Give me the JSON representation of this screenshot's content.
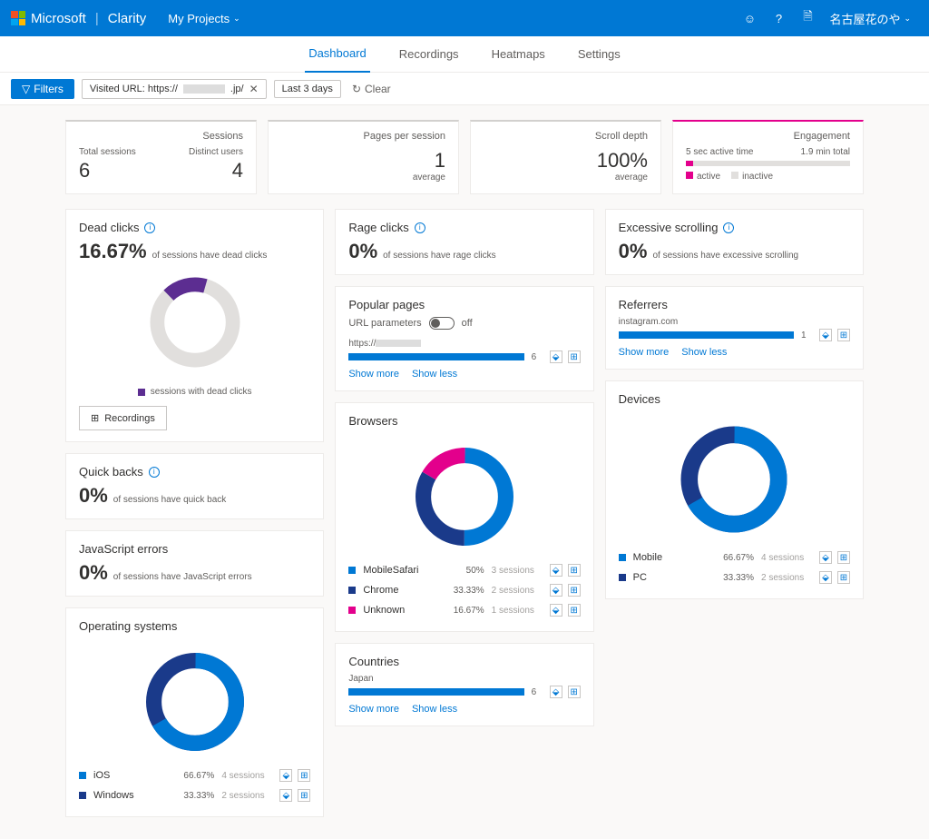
{
  "header": {
    "brand_ms": "Microsoft",
    "brand_app": "Clarity",
    "my_projects": "My Projects",
    "user": "名古屋花のや"
  },
  "tabs": {
    "dashboard": "Dashboard",
    "recordings": "Recordings",
    "heatmaps": "Heatmaps",
    "settings": "Settings"
  },
  "filter_bar": {
    "filters": "Filters",
    "chip_url_prefix": "Visited URL: https://",
    "chip_url_suffix": ".jp/",
    "chip_date": "Last 3 days",
    "clear": "Clear"
  },
  "metrics": {
    "sessions": {
      "title": "Sessions",
      "total_label": "Total sessions",
      "total_value": "6",
      "distinct_label": "Distinct users",
      "distinct_value": "4"
    },
    "pps": {
      "title": "Pages per session",
      "value": "1",
      "sub": "average"
    },
    "scroll": {
      "title": "Scroll depth",
      "value": "100%",
      "sub": "average"
    },
    "engagement": {
      "title": "Engagement",
      "active_label": "5 sec active time",
      "total_label": "1.9 min total",
      "legend_active": "active",
      "legend_inactive": "inactive"
    }
  },
  "cards": {
    "dead_clicks": {
      "title": "Dead clicks",
      "pct": "16.67%",
      "desc": "of sessions have dead clicks",
      "legend": "sessions with dead clicks",
      "btn": "Recordings"
    },
    "quick_backs": {
      "title": "Quick backs",
      "pct": "0%",
      "desc": "of sessions have quick back"
    },
    "js_errors": {
      "title": "JavaScript errors",
      "pct": "0%",
      "desc": "of sessions have JavaScript errors"
    },
    "os": {
      "title": "Operating systems"
    },
    "rage": {
      "title": "Rage clicks",
      "pct": "0%",
      "desc": "of sessions have rage clicks"
    },
    "popular": {
      "title": "Popular pages",
      "params_label": "URL parameters",
      "toggle_state": "off",
      "url_prefix": "https://",
      "count": "6",
      "show_more": "Show more",
      "show_less": "Show less"
    },
    "browsers": {
      "title": "Browsers"
    },
    "countries": {
      "title": "Countries",
      "item": "Japan",
      "count": "6",
      "show_more": "Show more",
      "show_less": "Show less"
    },
    "excessive": {
      "title": "Excessive scrolling",
      "pct": "0%",
      "desc": "of sessions have excessive scrolling"
    },
    "referrers": {
      "title": "Referrers",
      "item": "instagram.com",
      "count": "1",
      "show_more": "Show more",
      "show_less": "Show less"
    },
    "devices": {
      "title": "Devices"
    }
  },
  "chart_data": {
    "dead_clicks_donut": {
      "type": "pie",
      "series": [
        {
          "name": "sessions with dead clicks",
          "value": 16.67,
          "color": "#5c2d91"
        },
        {
          "name": "other",
          "value": 83.33,
          "color": "#e1dfdd"
        }
      ]
    },
    "os_donut": {
      "type": "pie",
      "series": [
        {
          "name": "iOS",
          "value": 66.67,
          "sessions": "4 sessions",
          "color": "#0078d4"
        },
        {
          "name": "Windows",
          "value": 33.33,
          "sessions": "2 sessions",
          "color": "#1a3a8a"
        }
      ]
    },
    "browsers_donut": {
      "type": "pie",
      "series": [
        {
          "name": "MobileSafari",
          "value": 50,
          "sessions": "3 sessions",
          "color": "#0078d4"
        },
        {
          "name": "Chrome",
          "value": 33.33,
          "sessions": "2 sessions",
          "color": "#1a3a8a"
        },
        {
          "name": "Unknown",
          "value": 16.67,
          "sessions": "1 sessions",
          "color": "#e3008c"
        }
      ]
    },
    "devices_donut": {
      "type": "pie",
      "series": [
        {
          "name": "Mobile",
          "value": 66.67,
          "sessions": "4 sessions",
          "color": "#0078d4"
        },
        {
          "name": "PC",
          "value": 33.33,
          "sessions": "2 sessions",
          "color": "#1a3a8a"
        }
      ]
    },
    "engagement_bar": {
      "type": "bar",
      "active_fraction": 0.044
    }
  }
}
